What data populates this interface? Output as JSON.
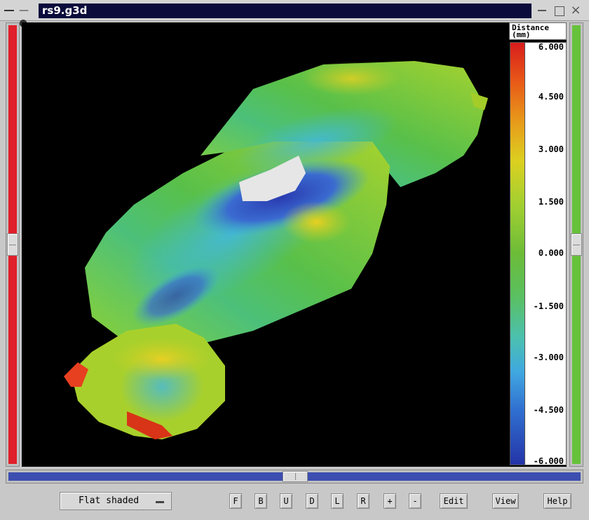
{
  "window": {
    "title": "rs9.g3d"
  },
  "legend": {
    "title_line1": "Distance",
    "title_line2": "(mm)",
    "ticks": [
      "6.000",
      "4.500",
      "3.000",
      "1.500",
      "0.000",
      "-1.500",
      "-3.000",
      "-4.500",
      "-6.000"
    ],
    "range": [
      -6,
      6
    ],
    "colors": [
      "#d81c1c",
      "#e8961a",
      "#dcd020",
      "#6cbc38",
      "#40a8e0",
      "#2434a8"
    ]
  },
  "toolbar": {
    "shade_mode": "Flat shaded",
    "buttons": [
      "F",
      "B",
      "U",
      "D",
      "L",
      "R",
      "+",
      "-",
      "Edit",
      "View",
      "Help"
    ]
  }
}
